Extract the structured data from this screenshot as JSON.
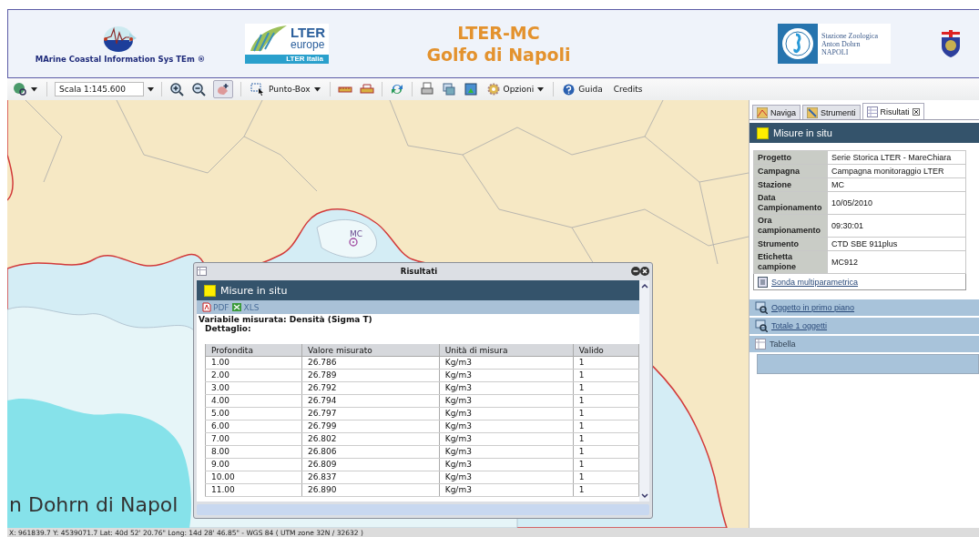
{
  "header": {
    "system_name": "MArine Coastal Information Sys TEm ®",
    "lter_logo": {
      "name": "LTER",
      "sub": "europe",
      "band": "LTER Italia"
    },
    "title_lines": [
      "LTER-MC",
      "Golfo di Napoli"
    ],
    "szn_logo": {
      "lines": [
        "Stazione Zoologica",
        "Anton Dohrn",
        "NAPOLI"
      ]
    }
  },
  "toolbar": {
    "scale": "Scala 1:145.600",
    "punto_box": "Punto-Box",
    "opzioni": "Opzioni",
    "guida": "Guida",
    "credits": "Credits"
  },
  "map": {
    "marker_label": "MC",
    "place_label": "n Dohrn di Napol"
  },
  "side_panel": {
    "tabs": [
      {
        "label": "Naviga",
        "selected": false
      },
      {
        "label": "Strumenti",
        "selected": false
      },
      {
        "label": "Risultati",
        "selected": true
      }
    ],
    "title": "Misure in situ",
    "fields": [
      {
        "label": "Progetto",
        "value": "Serie Storica LTER - MareChiara"
      },
      {
        "label": "Campagna",
        "value": "Campagna monitoraggio LTER"
      },
      {
        "label": "Stazione",
        "value": "MC"
      },
      {
        "label": "Data Campionamento",
        "value": "10/05/2010"
      },
      {
        "label": "Ora campionamento",
        "value": "09:30:01"
      },
      {
        "label": "Strumento",
        "value": "CTD SBE 911plus"
      },
      {
        "label": "Etichetta campione",
        "value": "MC912"
      }
    ],
    "link": "Sonda multiparametrica",
    "sections": [
      {
        "label": "Oggetto in primo piano",
        "kind": "link"
      },
      {
        "label": "Totale 1 oggetti",
        "kind": "link"
      },
      {
        "label": "Tabella",
        "kind": "plain"
      }
    ]
  },
  "window": {
    "title": "Risultati",
    "header": "Misure in situ",
    "exports": [
      "PDF",
      "XLS"
    ],
    "variable": "Variabile misurata: Densità (Sigma T)",
    "detail": "Dettaglio:",
    "columns": [
      "Profondita",
      "Valore misurato",
      "Unità di misura",
      "Valido"
    ],
    "rows": [
      [
        "1.00",
        "26.786",
        "Kg/m3",
        "1"
      ],
      [
        "2.00",
        "26.789",
        "Kg/m3",
        "1"
      ],
      [
        "3.00",
        "26.792",
        "Kg/m3",
        "1"
      ],
      [
        "4.00",
        "26.794",
        "Kg/m3",
        "1"
      ],
      [
        "5.00",
        "26.797",
        "Kg/m3",
        "1"
      ],
      [
        "6.00",
        "26.799",
        "Kg/m3",
        "1"
      ],
      [
        "7.00",
        "26.802",
        "Kg/m3",
        "1"
      ],
      [
        "8.00",
        "26.806",
        "Kg/m3",
        "1"
      ],
      [
        "9.00",
        "26.809",
        "Kg/m3",
        "1"
      ],
      [
        "10.00",
        "26.837",
        "Kg/m3",
        "1"
      ],
      [
        "11.00",
        "26.890",
        "Kg/m3",
        "1"
      ]
    ]
  },
  "status_bar": "X: 961839.7 Y: 4539071.7 Lat: 40d 52' 20.76\" Long: 14d 28' 46.85\" - WGS 84 ( UTM zone 32N / 32632 )"
}
